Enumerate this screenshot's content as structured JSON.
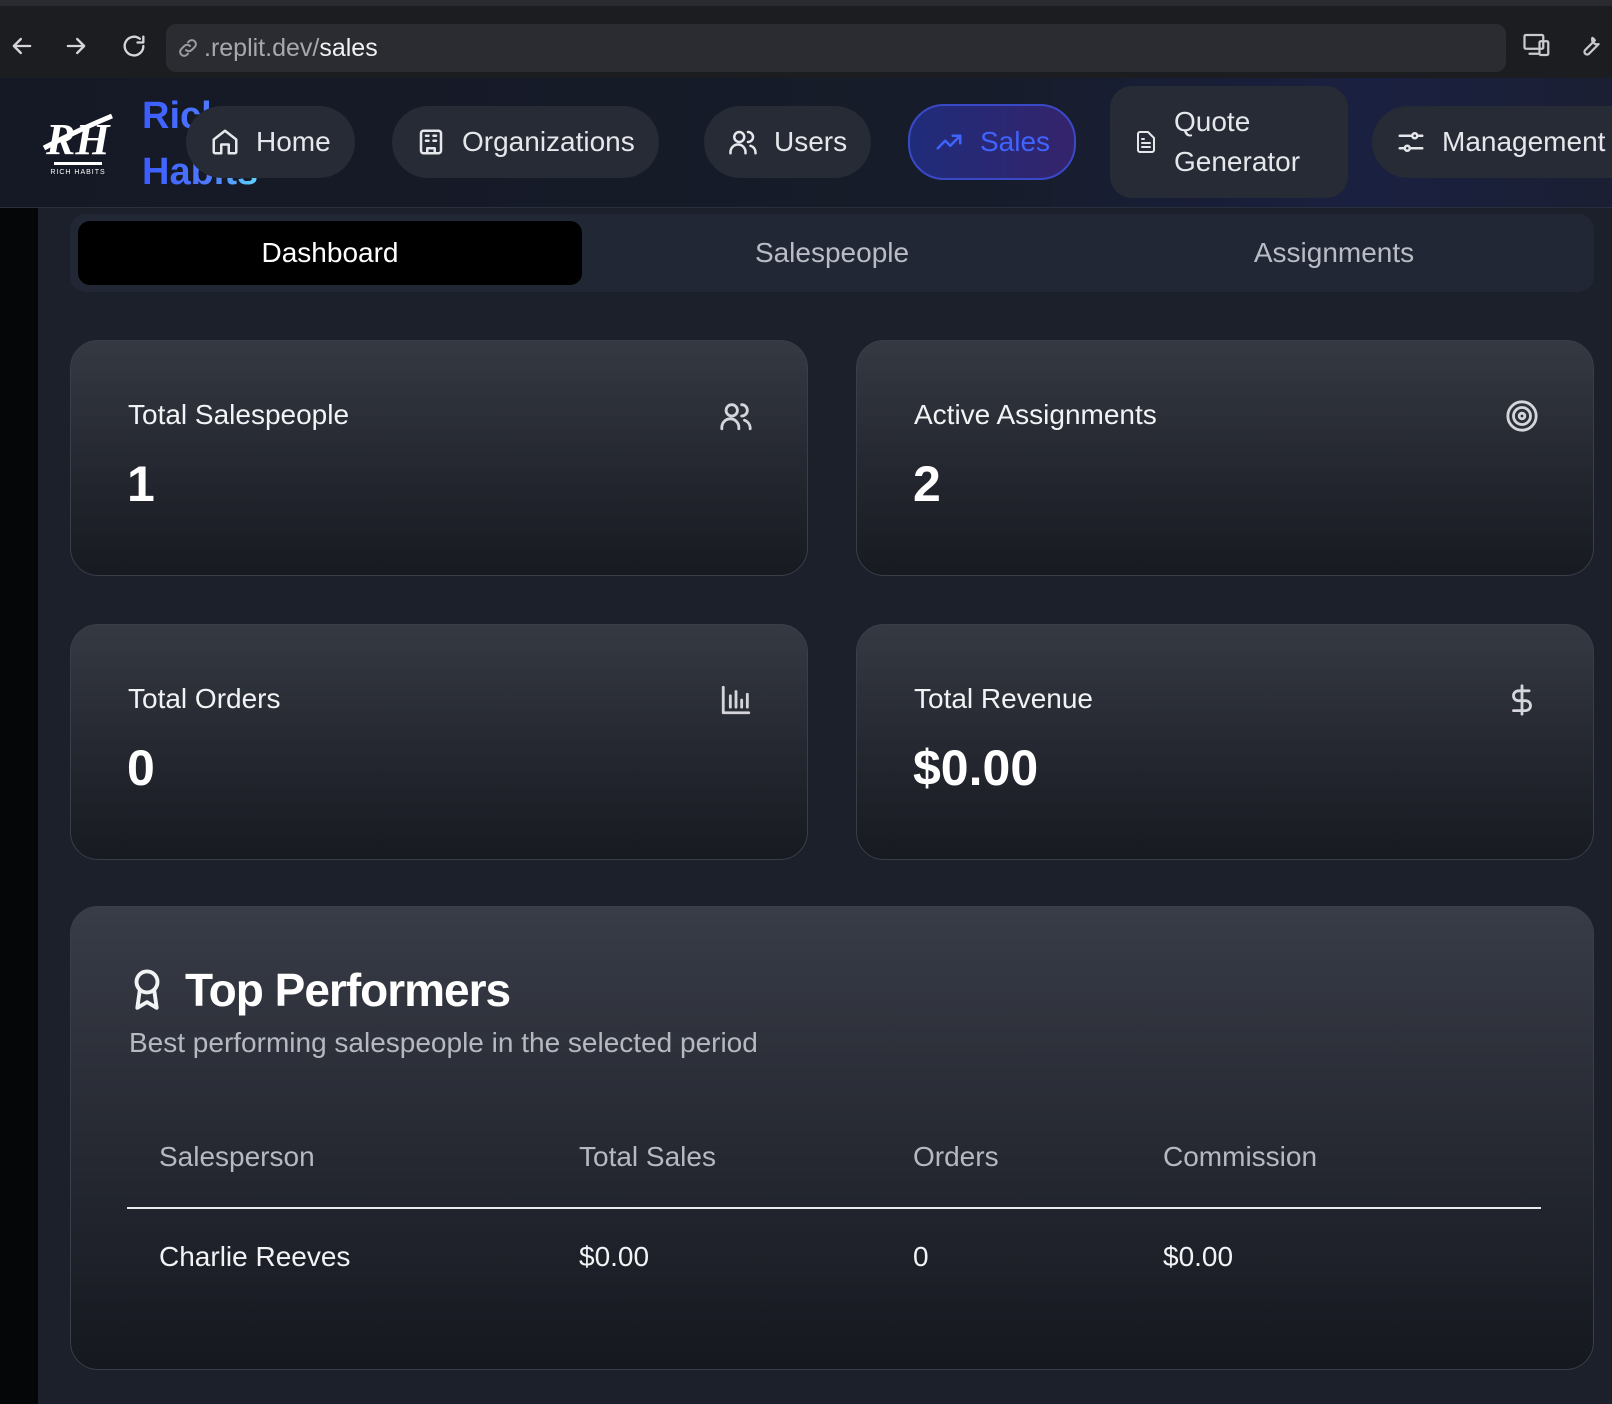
{
  "browser": {
    "url_host": ".replit.dev/",
    "url_path": "sales"
  },
  "header": {
    "brand_line1": "Rich",
    "brand_line2": "Habits",
    "nav": [
      {
        "label": "Home",
        "icon": "home-icon"
      },
      {
        "label": "Organizations",
        "icon": "building-icon"
      },
      {
        "label": "Users",
        "icon": "users-icon"
      },
      {
        "label": "Sales",
        "icon": "trending-up-icon",
        "active": true
      },
      {
        "label": "Quote Generator",
        "icon": "file-text-icon"
      },
      {
        "label": "Management",
        "icon": "sliders-icon"
      }
    ]
  },
  "tabs": [
    {
      "label": "Dashboard",
      "active": true
    },
    {
      "label": "Salespeople"
    },
    {
      "label": "Assignments"
    }
  ],
  "stats": [
    {
      "title": "Total Salespeople",
      "value": "1",
      "icon": "users-icon"
    },
    {
      "title": "Active Assignments",
      "value": "2",
      "icon": "target-icon"
    },
    {
      "title": "Total Orders",
      "value": "0",
      "icon": "bar-chart-icon"
    },
    {
      "title": "Total Revenue",
      "value": "$0.00",
      "icon": "dollar-icon"
    }
  ],
  "top_performers": {
    "title": "Top Performers",
    "subtitle": "Best performing salespeople in the selected period",
    "columns": [
      "Salesperson",
      "Total Sales",
      "Orders",
      "Commission"
    ],
    "rows": [
      [
        "Charlie Reeves",
        "$0.00",
        "0",
        "$0.00"
      ]
    ]
  },
  "colors": {
    "accent": "#3f63ff",
    "background": "#1b202b"
  }
}
